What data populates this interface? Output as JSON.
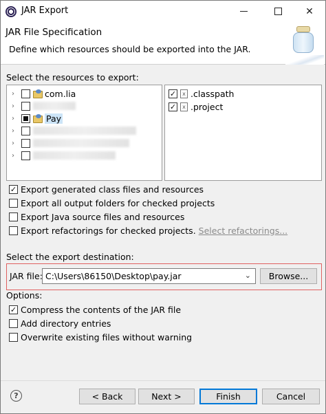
{
  "window": {
    "title": "JAR Export"
  },
  "header": {
    "title": "JAR File Specification",
    "description": "Define which resources should be exported into the JAR."
  },
  "resources": {
    "label": "Select the resources to export:",
    "projects": [
      {
        "name": "com.lia",
        "state": "unchecked"
      },
      {
        "name": "",
        "state": "unchecked"
      },
      {
        "name": "Pay",
        "state": "partial"
      },
      {
        "name": "",
        "state": "unchecked"
      },
      {
        "name": "",
        "state": "unchecked"
      },
      {
        "name": "",
        "state": "unchecked"
      }
    ],
    "files": [
      {
        "name": ".classpath",
        "state": "checked"
      },
      {
        "name": ".project",
        "state": "checked"
      }
    ]
  },
  "export_options": {
    "generated_class_files": {
      "label": "Export generated class files and resources",
      "checked": true
    },
    "output_folders": {
      "label": "Export all output folders for checked projects",
      "checked": false
    },
    "java_source": {
      "label": "Export Java source files and resources",
      "checked": false
    },
    "refactorings": {
      "label": "Export refactorings for checked projects.",
      "checked": false
    },
    "select_refactorings_link": "Select refactorings..."
  },
  "destination": {
    "label": "Select the export destination:",
    "jar_file_label": "JAR file:",
    "jar_file_value": "C:\\Users\\86150\\Desktop\\pay.jar",
    "browse_label": "Browse..."
  },
  "options": {
    "label": "Options:",
    "compress": {
      "label": "Compress the contents of the JAR file",
      "checked": true
    },
    "directory_entries": {
      "label": "Add directory entries",
      "checked": false
    },
    "overwrite": {
      "label": "Overwrite existing files without warning",
      "checked": false
    }
  },
  "buttons": {
    "back": "< Back",
    "next": "Next >",
    "finish": "Finish",
    "cancel": "Cancel"
  }
}
